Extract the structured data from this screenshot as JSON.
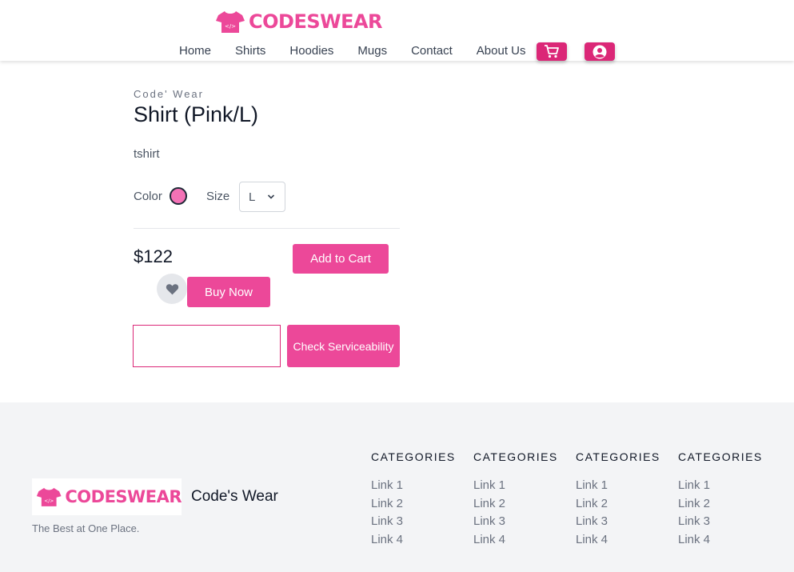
{
  "header": {
    "logo_text": "CODESWEAR",
    "nav": [
      "Home",
      "Shirts",
      "Hoodies",
      "Mugs",
      "Contact",
      "About Us"
    ],
    "cart_icon": "cart-icon",
    "user_icon": "user-circle-icon",
    "accent_color": "#db2777"
  },
  "product": {
    "brand": "Code' Wear",
    "title": "Shirt (Pink/L)",
    "description": "tshirt",
    "color_label": "Color",
    "selected_color": "#f472b6",
    "size_label": "Size",
    "size_value": "L",
    "price": "$122",
    "add_to_cart": "Add to Cart",
    "buy_now": "Buy Now",
    "wishlist_icon": "heart-icon",
    "pincode_value": "",
    "check_label": "Check Serviceability"
  },
  "footer": {
    "logo_text": "CODESWEAR",
    "brand": "Code's Wear",
    "tagline": "The Best at One Place.",
    "columns": [
      {
        "heading": "CATEGORIES",
        "links": [
          "Link 1",
          "Link 2",
          "Link 3",
          "Link 4"
        ]
      },
      {
        "heading": "CATEGORIES",
        "links": [
          "Link 1",
          "Link 2",
          "Link 3",
          "Link 4"
        ]
      },
      {
        "heading": "CATEGORIES",
        "links": [
          "Link 1",
          "Link 2",
          "Link 3",
          "Link 4"
        ]
      },
      {
        "heading": "CATEGORIES",
        "links": [
          "Link 1",
          "Link 2",
          "Link 3",
          "Link 4"
        ]
      }
    ]
  }
}
